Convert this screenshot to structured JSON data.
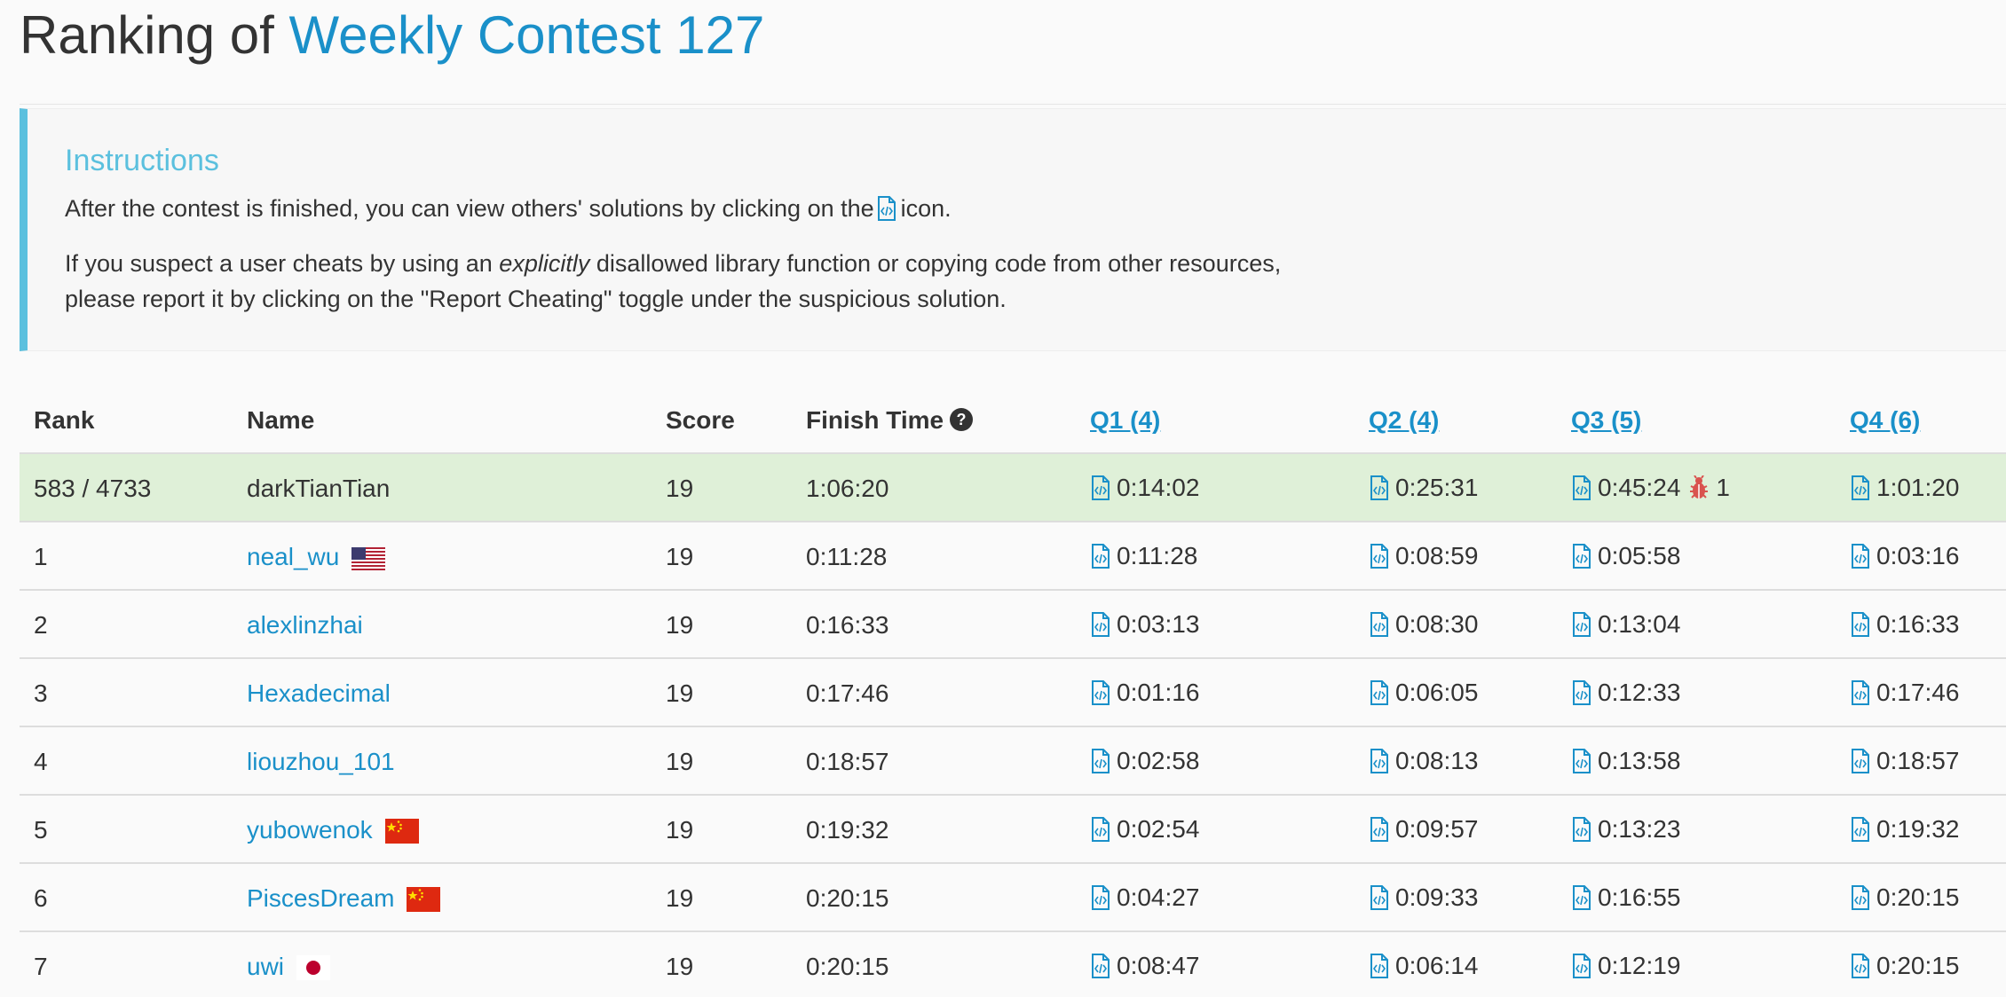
{
  "header": {
    "title_prefix": "Ranking of",
    "contest_link": "Weekly Contest 127"
  },
  "instructions": {
    "heading": "Instructions",
    "line1_before": "After the contest is finished, you can view others' solutions by clicking on the",
    "line1_after": "icon.",
    "line2_before": "If you suspect a user cheats by using an",
    "line2_emphasis": "explicitly",
    "line2_after": "disallowed library function or copying code from other resources,",
    "line3": "please report it by clicking on the \"Report Cheating\" toggle under the suspicious solution."
  },
  "table": {
    "headers": {
      "rank": "Rank",
      "name": "Name",
      "score": "Score",
      "finish": "Finish Time",
      "q1": "Q1 (4)",
      "q2": "Q2 (4)",
      "q3": "Q3 (5)",
      "q4": "Q4 (6)"
    },
    "rows": [
      {
        "rank": "583 / 4733",
        "name": "darkTianTian",
        "is_self": true,
        "flag": "",
        "score": "19",
        "finish": "1:06:20",
        "q1": "0:14:02",
        "q2": "0:25:31",
        "q3": "0:45:24",
        "q3_bugs": "1",
        "q4": "1:01:20"
      },
      {
        "rank": "1",
        "name": "neal_wu",
        "flag": "us",
        "score": "19",
        "finish": "0:11:28",
        "q1": "0:11:28",
        "q2": "0:08:59",
        "q3": "0:05:58",
        "q4": "0:03:16"
      },
      {
        "rank": "2",
        "name": "alexlinzhai",
        "flag": "",
        "score": "19",
        "finish": "0:16:33",
        "q1": "0:03:13",
        "q2": "0:08:30",
        "q3": "0:13:04",
        "q4": "0:16:33"
      },
      {
        "rank": "3",
        "name": "Hexadecimal",
        "flag": "",
        "score": "19",
        "finish": "0:17:46",
        "q1": "0:01:16",
        "q2": "0:06:05",
        "q3": "0:12:33",
        "q4": "0:17:46"
      },
      {
        "rank": "4",
        "name": "liouzhou_101",
        "flag": "",
        "score": "19",
        "finish": "0:18:57",
        "q1": "0:02:58",
        "q2": "0:08:13",
        "q3": "0:13:58",
        "q4": "0:18:57"
      },
      {
        "rank": "5",
        "name": "yubowenok",
        "flag": "cn",
        "score": "19",
        "finish": "0:19:32",
        "q1": "0:02:54",
        "q2": "0:09:57",
        "q3": "0:13:23",
        "q4": "0:19:32"
      },
      {
        "rank": "6",
        "name": "PiscesDream",
        "flag": "cn",
        "score": "19",
        "finish": "0:20:15",
        "q1": "0:04:27",
        "q2": "0:09:33",
        "q3": "0:16:55",
        "q4": "0:20:15"
      },
      {
        "rank": "7",
        "name": "uwi",
        "flag": "jp",
        "score": "19",
        "finish": "0:20:15",
        "q1": "0:08:47",
        "q2": "0:06:14",
        "q3": "0:12:19",
        "q4": "0:20:15"
      }
    ]
  },
  "colors": {
    "link": "#1a90c9",
    "info_accent": "#5bc0de",
    "self_row_bg": "#dff0d8",
    "bug": "#d9534f"
  }
}
